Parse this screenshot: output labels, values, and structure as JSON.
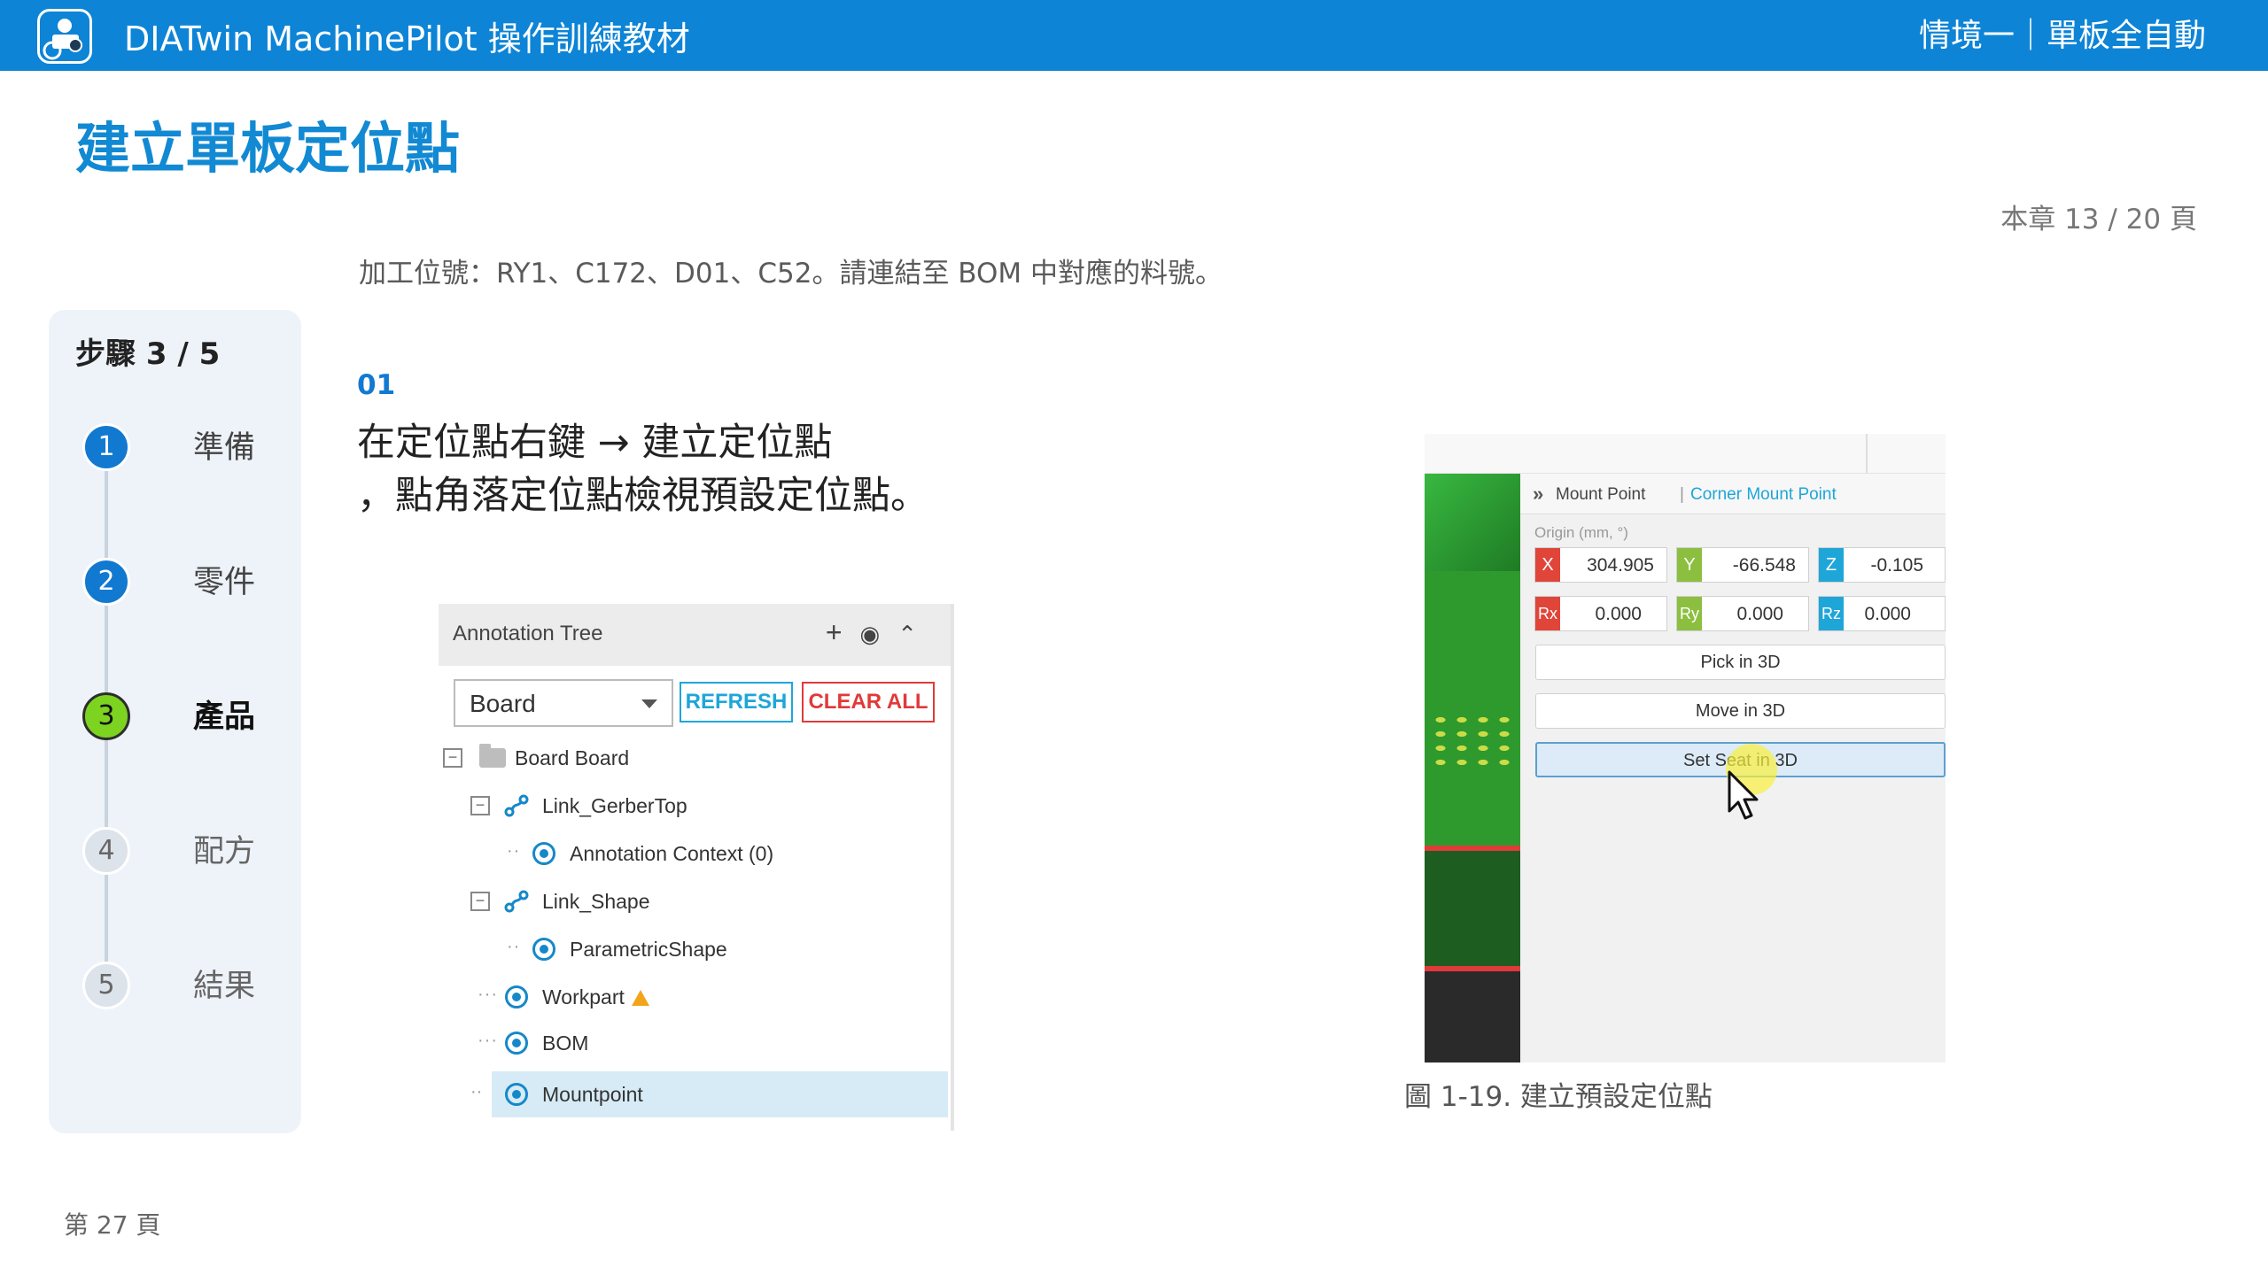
{
  "header": {
    "app_title": "DIATwin MachinePilot 操作訓練教材",
    "scenario": "情境一｜單板全自動"
  },
  "page_title": "建立單板定位點",
  "chapter_page": "本章 13 / 20 頁",
  "intro": "加工位號：RY1、C172、D01、C52。請連結至 BOM 中對應的料號。",
  "steps": {
    "title": "步驟 3 / 5",
    "items": [
      {
        "num": "1",
        "label": "準備",
        "state": "done"
      },
      {
        "num": "2",
        "label": "零件",
        "state": "done"
      },
      {
        "num": "3",
        "label": "產品",
        "state": "active"
      },
      {
        "num": "4",
        "label": "配方",
        "state": "todo"
      },
      {
        "num": "5",
        "label": "結果",
        "state": "todo"
      }
    ]
  },
  "instruction": {
    "step_no": "01",
    "line1": "在定位點右鍵 → 建立定位點",
    "line2": "，點角落定位點檢視預設定位點。"
  },
  "annotation_tree": {
    "title": "Annotation Tree",
    "select_value": "Board",
    "refresh_label": "REFRESH",
    "clear_label": "CLEAR ALL",
    "nodes": [
      {
        "label": "Board  Board",
        "icon": "folder-icon"
      },
      {
        "label": "Link_GerberTop",
        "icon": "link-icon"
      },
      {
        "label": "Annotation Context (0)",
        "icon": "target-icon"
      },
      {
        "label": "Link_Shape",
        "icon": "link-icon"
      },
      {
        "label": "ParametricShape",
        "icon": "target-icon"
      },
      {
        "label": "Workpart",
        "icon": "target-icon",
        "warning": true
      },
      {
        "label": "BOM",
        "icon": "target-icon"
      },
      {
        "label": "Mountpoint",
        "icon": "target-icon",
        "selected": true
      }
    ]
  },
  "mount_point": {
    "title": "Mount Point",
    "separator": "|",
    "subtitle": "Corner Mount Point",
    "origin_label": "Origin (mm, °)",
    "x": {
      "tag": "X",
      "value": "304.905",
      "color": "#e0453a"
    },
    "y": {
      "tag": "Y",
      "value": "-66.548",
      "color": "#8cbf3f"
    },
    "z": {
      "tag": "Z",
      "value": "-0.105",
      "color": "#1fa6d8"
    },
    "rx": {
      "tag": "Rx",
      "value": "0.000",
      "color": "#e0453a"
    },
    "ry": {
      "tag": "Ry",
      "value": "0.000",
      "color": "#8cbf3f"
    },
    "rz": {
      "tag": "Rz",
      "value": "0.000",
      "color": "#1fa6d8"
    },
    "btn_pick": "Pick in 3D",
    "btn_move": "Move in 3D",
    "btn_seat": "Set Seat in 3D"
  },
  "caption": "圖 1-19. 建立預設定位點",
  "page_no": "第 27 頁",
  "colors": {
    "brand": "#0d84d6",
    "title": "#1289d3",
    "active_step": "#7cd320"
  }
}
